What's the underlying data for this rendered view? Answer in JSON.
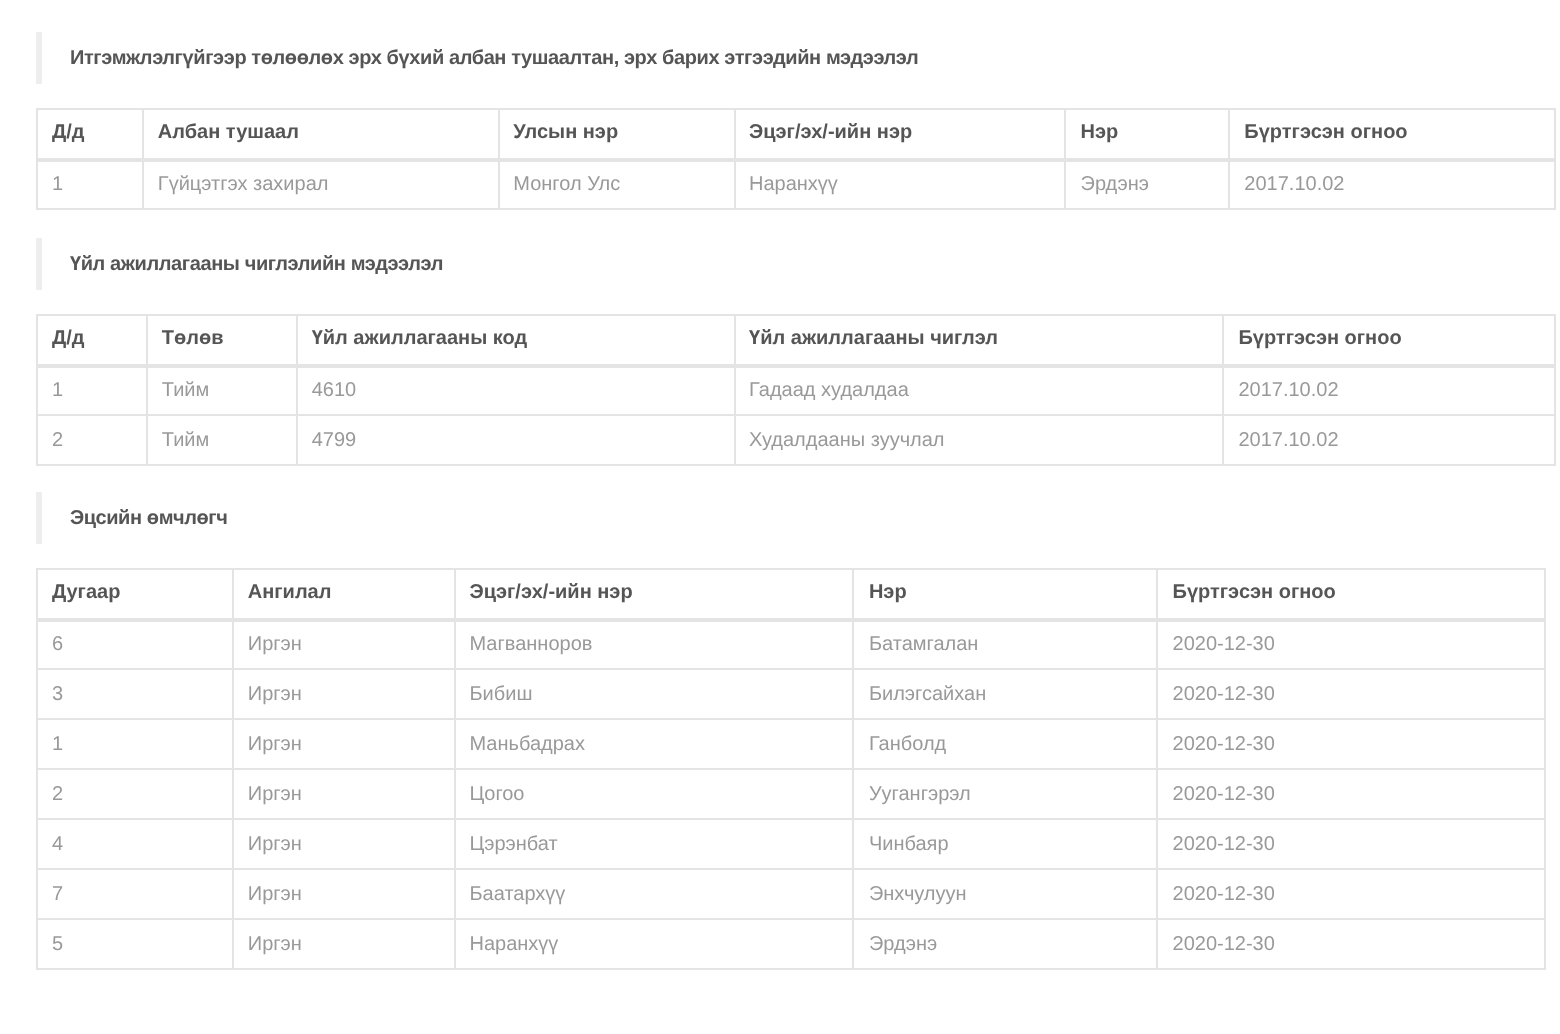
{
  "sections": [
    {
      "heading": "Итгэмжлэлгүйгээр төлөөлөх эрх бүхий албан тушаалтан, эрх барих этгээдийн мэдээлэл",
      "table": {
        "columns": [
          "Д/д",
          "Албан тушаал",
          "Улсын нэр",
          "Эцэг/эх/-ийн нэр",
          "Нэр",
          "Бүртгэсэн огноо"
        ],
        "rows": [
          [
            "1",
            "Гүйцэтгэх захирал",
            "Монгол Улс",
            "Наранхүү",
            "Эрдэнэ",
            "2017.10.02"
          ]
        ]
      }
    },
    {
      "heading": "Үйл ажиллагааны чиглэлийн мэдээлэл",
      "table": {
        "columns": [
          "Д/д",
          "Төлөв",
          "Үйл ажиллагааны код",
          "Үйл ажиллагааны чиглэл",
          "Бүртгэсэн огноо"
        ],
        "rows": [
          [
            "1",
            "Тийм",
            "4610",
            "Гадаад худалдаа",
            "2017.10.02"
          ],
          [
            "2",
            "Тийм",
            "4799",
            "Худалдааны зуучлал",
            "2017.10.02"
          ]
        ]
      }
    },
    {
      "heading": "Эцсийн өмчлөгч",
      "table": {
        "columns": [
          "Дугаар",
          "Ангилал",
          "Эцэг/эх/-ийн нэр",
          "Нэр",
          "Бүртгэсэн огноо"
        ],
        "rows": [
          [
            "6",
            "Иргэн",
            "Магванноров",
            "Батамгалан",
            "2020-12-30"
          ],
          [
            "3",
            "Иргэн",
            "Бибиш",
            "Билэгсайхан",
            "2020-12-30"
          ],
          [
            "1",
            "Иргэн",
            "Маньбадрах",
            "Ганболд",
            "2020-12-30"
          ],
          [
            "2",
            "Иргэн",
            "Цогоо",
            "Уугангэрэл",
            "2020-12-30"
          ],
          [
            "4",
            "Иргэн",
            "Цэрэнбат",
            "Чинбаяр",
            "2020-12-30"
          ],
          [
            "7",
            "Иргэн",
            "Баатархүү",
            "Энхчулуун",
            "2020-12-30"
          ],
          [
            "5",
            "Иргэн",
            "Наранхүү",
            "Эрдэнэ",
            "2020-12-30"
          ]
        ]
      }
    }
  ]
}
